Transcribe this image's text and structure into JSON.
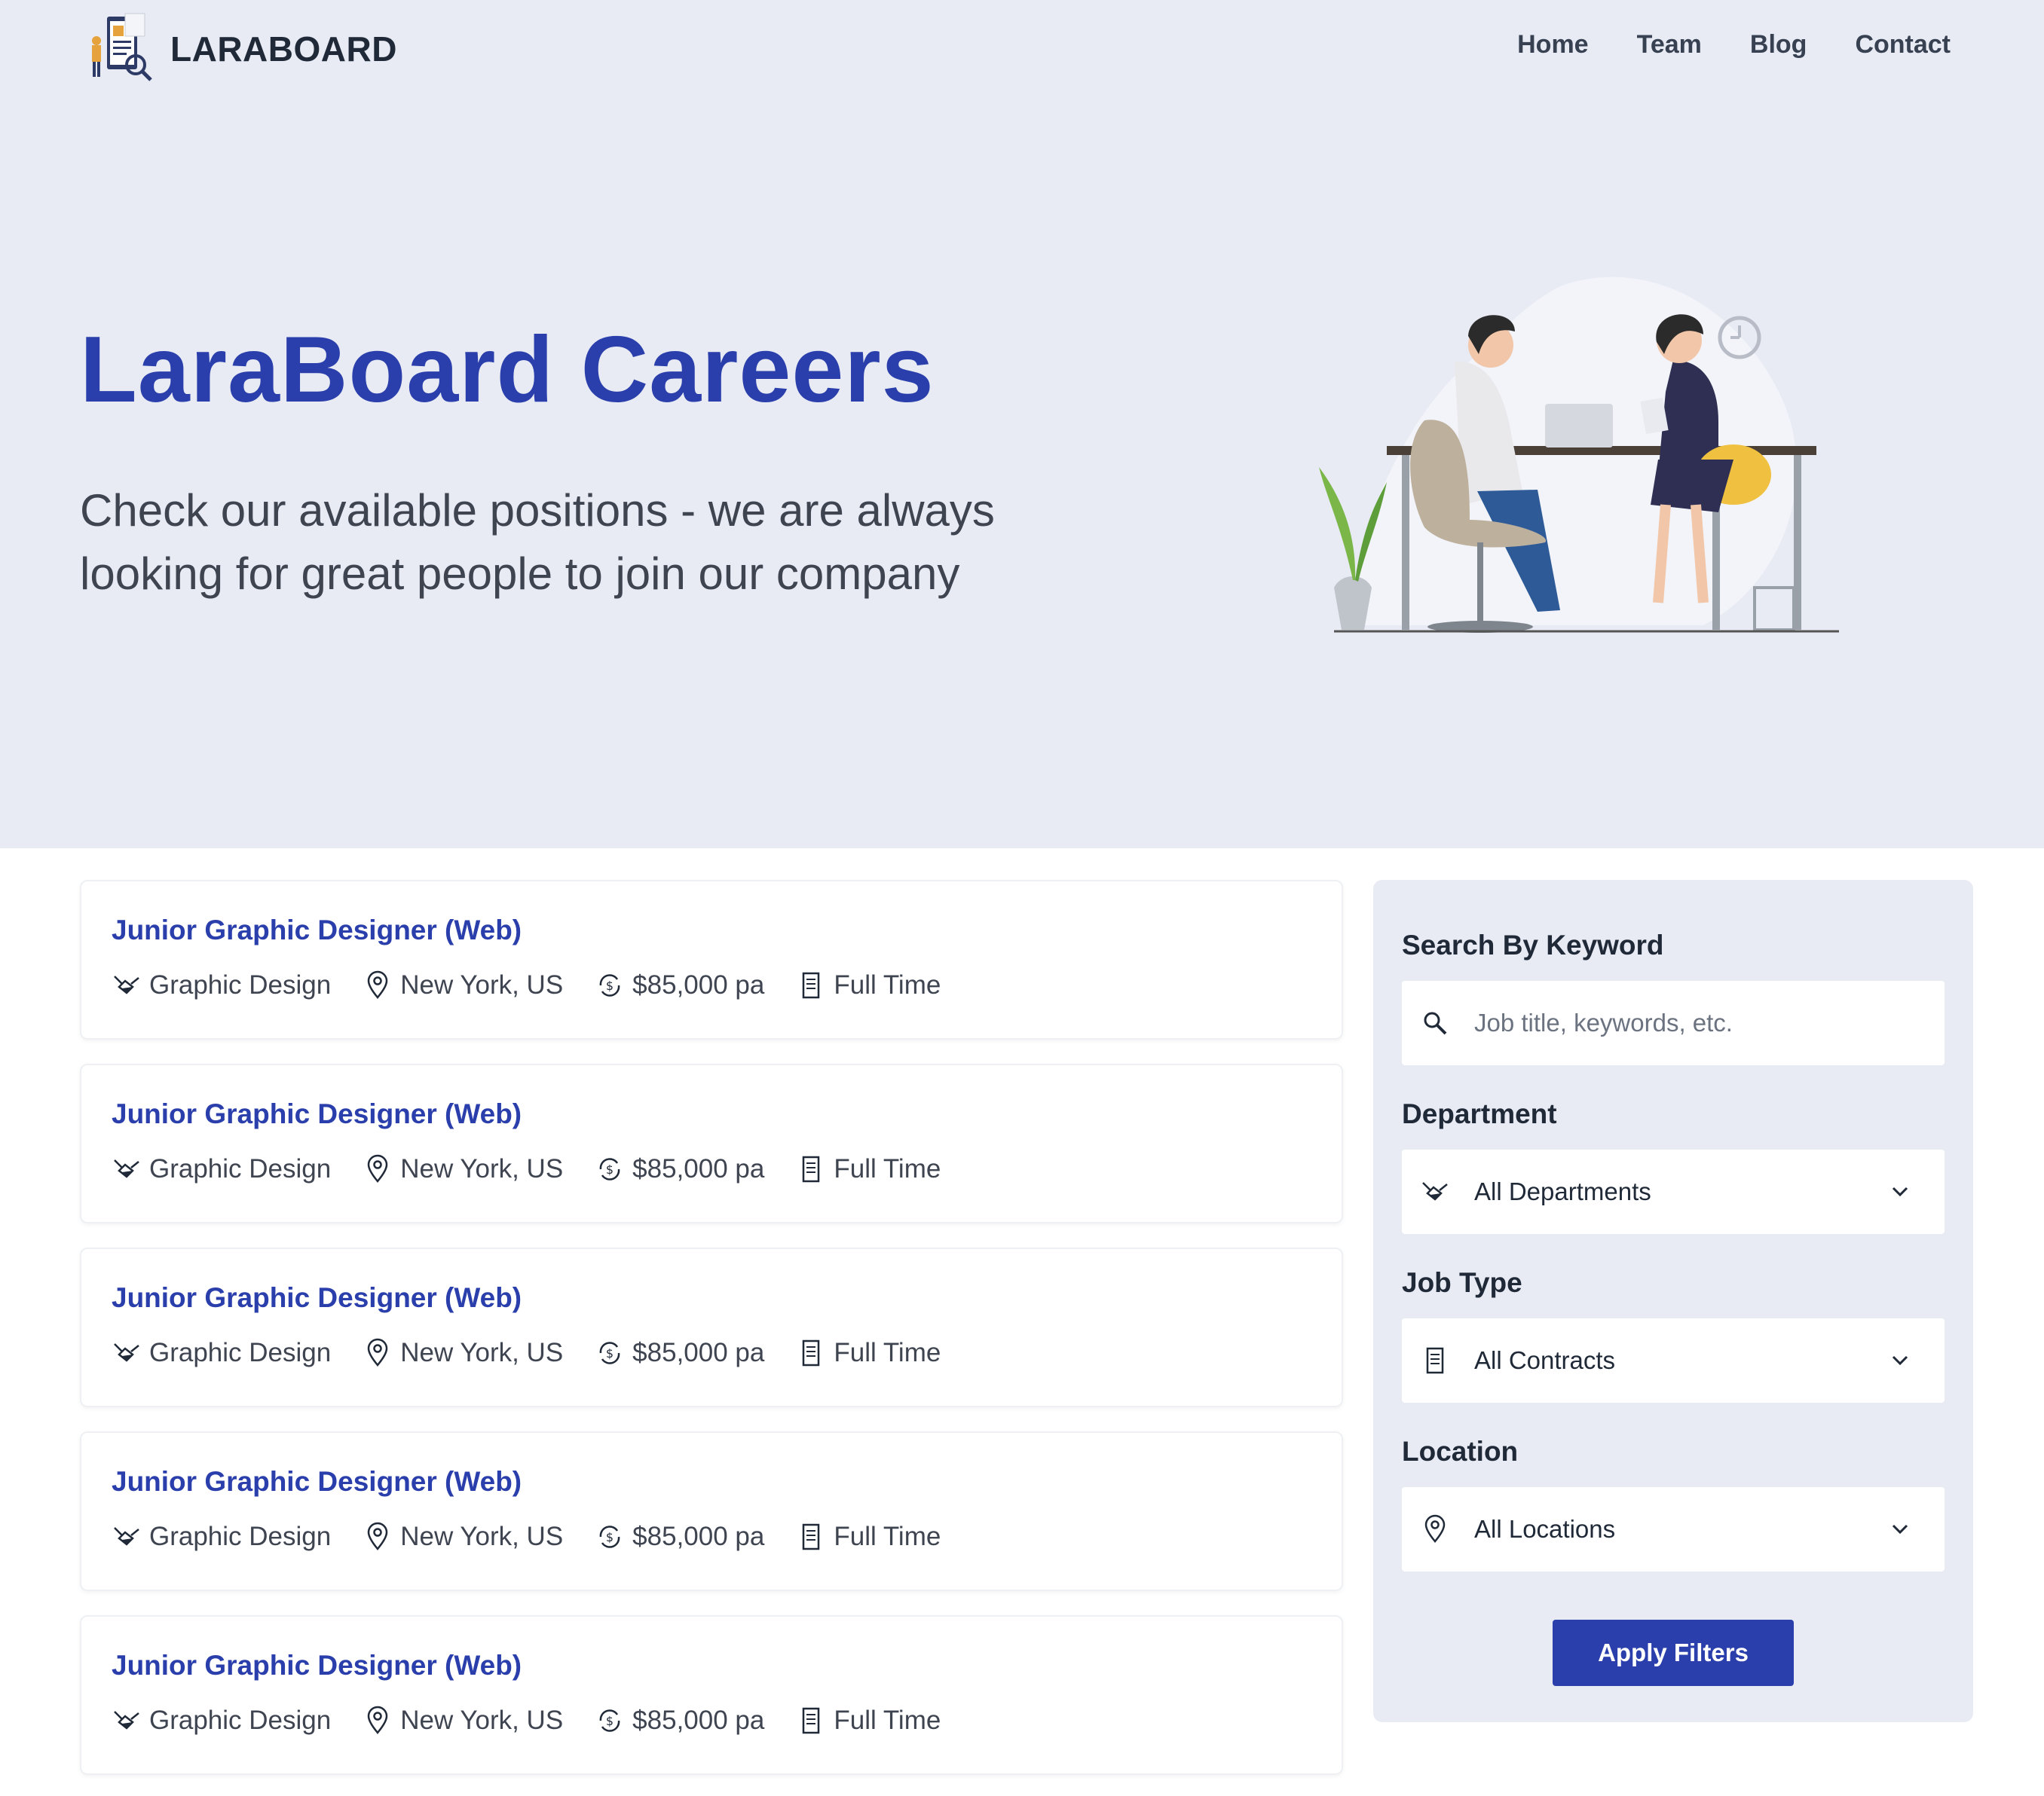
{
  "brand": {
    "name": "LARABOARD"
  },
  "nav": [
    "Home",
    "Team",
    "Blog",
    "Contact"
  ],
  "hero": {
    "title": "LaraBoard Careers",
    "subtitle": "Check our available positions - we are always looking for great people to join our company"
  },
  "jobs": [
    {
      "title": "Junior Graphic Designer (Web)",
      "department": "Graphic Design",
      "location": "New York, US",
      "salary": "$85,000 pa",
      "type": "Full Time"
    },
    {
      "title": "Junior Graphic Designer (Web)",
      "department": "Graphic Design",
      "location": "New York, US",
      "salary": "$85,000 pa",
      "type": "Full Time"
    },
    {
      "title": "Junior Graphic Designer (Web)",
      "department": "Graphic Design",
      "location": "New York, US",
      "salary": "$85,000 pa",
      "type": "Full Time"
    },
    {
      "title": "Junior Graphic Designer (Web)",
      "department": "Graphic Design",
      "location": "New York, US",
      "salary": "$85,000 pa",
      "type": "Full Time"
    },
    {
      "title": "Junior Graphic Designer (Web)",
      "department": "Graphic Design",
      "location": "New York, US",
      "salary": "$85,000 pa",
      "type": "Full Time"
    }
  ],
  "filters": {
    "keyword": {
      "label": "Search By Keyword",
      "placeholder": "Job title, keywords, etc.",
      "value": ""
    },
    "department": {
      "label": "Department",
      "value": "All Departments"
    },
    "job_type": {
      "label": "Job Type",
      "value": "All Contracts"
    },
    "location": {
      "label": "Location",
      "value": "All Locations"
    },
    "apply_label": "Apply Filters"
  },
  "colors": {
    "accent": "#2a3fab",
    "hero_bg": "#e8ebf4",
    "text": "#374151"
  }
}
